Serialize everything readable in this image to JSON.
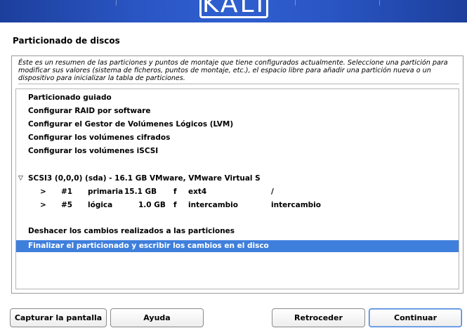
{
  "banner": {
    "logo_text": "KALI"
  },
  "section_title": "Particionado de discos",
  "description": "Éste es un resumen de las particiones y puntos de montaje que tiene configurados actualmente. Seleccione una partición para modificar sus valores (sistema de ficheros, puntos de montaje, etc.), el espacio libre para añadir una partición nueva o un dispositivo para inicializar la tabla de particiones.",
  "menu": {
    "guided": "Particionado guiado",
    "raid": "Configurar RAID por software",
    "lvm": "Configurar el Gestor de Volúmenes Lógicos (LVM)",
    "encrypted": "Configurar los volúmenes cifrados",
    "iscsi": "Configurar los volúmenes iSCSI"
  },
  "disk": {
    "expander": "▽",
    "label": "SCSI3 (0,0,0) (sda) - 16.1 GB VMware, VMware Virtual S",
    "partitions": [
      {
        "arrow": ">",
        "number": "#1",
        "type": "primaria",
        "size": "15.1 GB",
        "flag": "f",
        "fs": "ext4",
        "mount": "/"
      },
      {
        "arrow": ">",
        "number": "#5",
        "type": "lógica",
        "size": "1.0 GB",
        "flag": "f",
        "fs": "intercambio",
        "mount": "intercambio"
      }
    ]
  },
  "actions": {
    "undo": "Deshacer los cambios realizados a las particiones",
    "finish": "Finalizar el particionado y escribir los cambios en el disco"
  },
  "buttons": {
    "screenshot": "Capturar la pantalla",
    "help": "Ayuda",
    "back": "Retroceder",
    "continue": "Continuar"
  },
  "colors": {
    "selection": "#3f7fdc",
    "banner": "#2a56c4"
  }
}
